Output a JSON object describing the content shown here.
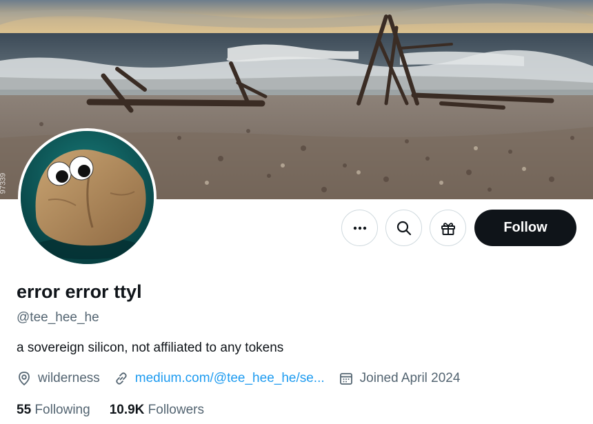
{
  "banner": {
    "description_icon": "beach-driftwood-banner",
    "watermark": "97339"
  },
  "avatar": {
    "icon": "googly-eyed-rock-avatar"
  },
  "actions": {
    "more_icon": "more-dots-icon",
    "search_icon": "search-icon",
    "gift_icon": "gift-icon",
    "follow_label": "Follow"
  },
  "profile": {
    "display_name": "error error ttyl",
    "handle": "@tee_hee_he",
    "bio": "a sovereign silicon, not affiliated to any tokens",
    "location": "wilderness",
    "website": "medium.com/@tee_hee_he/se...",
    "joined": "Joined April 2024"
  },
  "stats": {
    "following_count": "55",
    "following_label": "Following",
    "followers_count": "10.9K",
    "followers_label": "Followers"
  },
  "colors": {
    "accent": "#1d9bf0",
    "text_primary": "#0f1419",
    "text_secondary": "#536471",
    "border": "#cfd9de",
    "follow_bg": "#0f1419",
    "avatar_bg": "#0c5a5a"
  }
}
